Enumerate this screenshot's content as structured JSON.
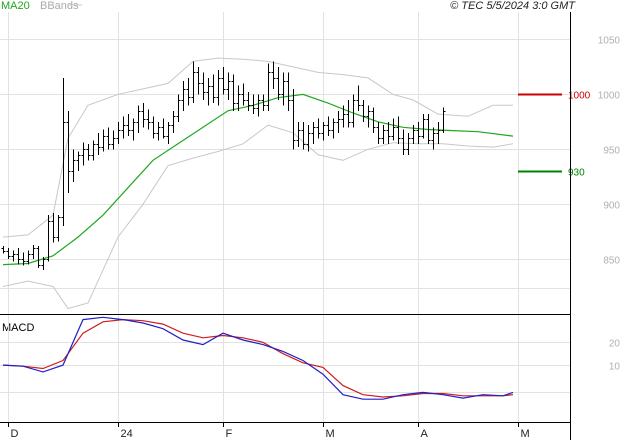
{
  "header": {
    "ma_label": "MA20",
    "bb_label": "BBands",
    "copyright": "© TEC 5/5/2024 3:0 GMT"
  },
  "colors": {
    "candles": "#000000",
    "ma20": "#1fa81f",
    "bbands": "#c8c8c8",
    "resistance": "#cc0000",
    "support": "#008000",
    "macd": "#1f1fcc",
    "signal": "#cc1f1f"
  },
  "chart_data": [
    {
      "type": "line",
      "title": "",
      "x_ticks": [
        {
          "label": "D",
          "index": 1
        },
        {
          "label": "24",
          "index": 23
        },
        {
          "label": "F",
          "index": 44
        },
        {
          "label": "M",
          "index": 64
        },
        {
          "label": "A",
          "index": 83
        },
        {
          "label": "M",
          "index": 103
        }
      ],
      "y_ticks": [
        850,
        900,
        950,
        1000,
        1050
      ],
      "ylim": [
        800,
        1075
      ],
      "grid": true,
      "levels": [
        {
          "name": "resistance",
          "value": 1000,
          "label": "1000"
        },
        {
          "name": "support",
          "value": 930,
          "label": "930"
        }
      ],
      "ohlc": [
        [
          860,
          862,
          855,
          857
        ],
        [
          857,
          860,
          850,
          853
        ],
        [
          853,
          858,
          848,
          855
        ],
        [
          855,
          860,
          845,
          850
        ],
        [
          850,
          856,
          844,
          848
        ],
        [
          848,
          858,
          845,
          855
        ],
        [
          855,
          863,
          850,
          860
        ],
        [
          860,
          862,
          842,
          845
        ],
        [
          845,
          852,
          840,
          850
        ],
        [
          850,
          890,
          848,
          885
        ],
        [
          885,
          892,
          865,
          870
        ],
        [
          870,
          890,
          866,
          888
        ],
        [
          888,
          1015,
          880,
          975
        ],
        [
          975,
          985,
          910,
          930
        ],
        [
          930,
          950,
          920,
          940
        ],
        [
          940,
          948,
          930,
          945
        ],
        [
          945,
          956,
          935,
          950
        ],
        [
          950,
          955,
          940,
          945
        ],
        [
          945,
          958,
          940,
          955
        ],
        [
          955,
          965,
          945,
          952
        ],
        [
          952,
          968,
          948,
          962
        ],
        [
          962,
          970,
          950,
          955
        ],
        [
          955,
          967,
          950,
          960
        ],
        [
          960,
          975,
          955,
          968
        ],
        [
          968,
          980,
          960,
          972
        ],
        [
          972,
          982,
          962,
          968
        ],
        [
          968,
          978,
          958,
          975
        ],
        [
          975,
          990,
          965,
          985
        ],
        [
          985,
          992,
          970,
          978
        ],
        [
          978,
          986,
          968,
          975
        ],
        [
          975,
          980,
          960,
          965
        ],
        [
          965,
          975,
          958,
          970
        ],
        [
          970,
          978,
          960,
          962
        ],
        [
          962,
          975,
          955,
          972
        ],
        [
          972,
          985,
          965,
          980
        ],
        [
          980,
          1000,
          975,
          995
        ],
        [
          995,
          1012,
          985,
          1005
        ],
        [
          1005,
          1015,
          990,
          998
        ],
        [
          998,
          1030,
          992,
          1020
        ],
        [
          1020,
          1025,
          1000,
          1010
        ],
        [
          1010,
          1020,
          995,
          1002
        ],
        [
          1002,
          1015,
          990,
          1008
        ],
        [
          1008,
          1018,
          992,
          998
        ],
        [
          998,
          1022,
          990,
          1015
        ],
        [
          1015,
          1025,
          1000,
          1005
        ],
        [
          1005,
          1020,
          995,
          1012
        ],
        [
          1012,
          1018,
          985,
          992
        ],
        [
          992,
          1008,
          985,
          1000
        ],
        [
          1000,
          1010,
          990,
          995
        ],
        [
          995,
          1002,
          985,
          990
        ],
        [
          990,
          1000,
          982,
          988
        ],
        [
          988,
          1000,
          980,
          995
        ],
        [
          995,
          1000,
          985,
          990
        ],
        [
          990,
          1028,
          985,
          1020
        ],
        [
          1020,
          1030,
          1005,
          1015
        ],
        [
          1015,
          1025,
          995,
          1000
        ],
        [
          1000,
          1020,
          990,
          1012
        ],
        [
          1012,
          1020,
          985,
          995
        ],
        [
          995,
          1005,
          950,
          958
        ],
        [
          958,
          975,
          952,
          968
        ],
        [
          968,
          975,
          950,
          955
        ],
        [
          955,
          972,
          948,
          965
        ],
        [
          965,
          975,
          955,
          970
        ],
        [
          970,
          978,
          960,
          965
        ],
        [
          965,
          975,
          958,
          972
        ],
        [
          972,
          980,
          962,
          968
        ],
        [
          968,
          978,
          960,
          975
        ],
        [
          975,
          985,
          965,
          978
        ],
        [
          978,
          990,
          970,
          982
        ],
        [
          982,
          995,
          970,
          975
        ],
        [
          975,
          1000,
          970,
          995
        ],
        [
          995,
          1008,
          985,
          990
        ],
        [
          990,
          995,
          975,
          980
        ],
        [
          980,
          990,
          970,
          985
        ],
        [
          985,
          988,
          965,
          970
        ],
        [
          970,
          975,
          955,
          960
        ],
        [
          960,
          972,
          955,
          968
        ],
        [
          968,
          975,
          955,
          962
        ],
        [
          962,
          978,
          958,
          970
        ],
        [
          970,
          980,
          955,
          960
        ],
        [
          960,
          968,
          945,
          950
        ],
        [
          950,
          965,
          945,
          960
        ],
        [
          960,
          972,
          955,
          968
        ],
        [
          968,
          975,
          955,
          962
        ],
        [
          962,
          982,
          960,
          978
        ],
        [
          978,
          982,
          955,
          958
        ],
        [
          958,
          970,
          950,
          965
        ],
        [
          965,
          975,
          955,
          968
        ],
        [
          968,
          988,
          965,
          985
        ]
      ],
      "ma20": [
        [
          0,
          845
        ],
        [
          5,
          846
        ],
        [
          10,
          853
        ],
        [
          15,
          870
        ],
        [
          20,
          890
        ],
        [
          25,
          915
        ],
        [
          30,
          940
        ],
        [
          35,
          955
        ],
        [
          40,
          970
        ],
        [
          45,
          985
        ],
        [
          50,
          990
        ],
        [
          55,
          997
        ],
        [
          60,
          1000
        ],
        [
          65,
          992
        ],
        [
          70,
          983
        ],
        [
          75,
          975
        ],
        [
          80,
          970
        ],
        [
          85,
          968
        ],
        [
          90,
          967
        ],
        [
          95,
          966
        ],
        [
          102,
          962
        ]
      ],
      "bb_upper": [
        [
          0,
          870
        ],
        [
          5,
          872
        ],
        [
          10,
          890
        ],
        [
          13,
          960
        ],
        [
          17,
          990
        ],
        [
          23,
          1000
        ],
        [
          28,
          1005
        ],
        [
          33,
          1010
        ],
        [
          38,
          1030
        ],
        [
          43,
          1033
        ],
        [
          48,
          1032
        ],
        [
          53,
          1030
        ],
        [
          58,
          1025
        ],
        [
          63,
          1020
        ],
        [
          68,
          1018
        ],
        [
          73,
          1015
        ],
        [
          78,
          1000
        ],
        [
          82,
          995
        ],
        [
          87,
          982
        ],
        [
          93,
          980
        ],
        [
          98,
          990
        ],
        [
          102,
          990
        ]
      ],
      "bb_lower": [
        [
          0,
          825
        ],
        [
          5,
          830
        ],
        [
          10,
          825
        ],
        [
          13,
          805
        ],
        [
          17,
          810
        ],
        [
          20,
          840
        ],
        [
          23,
          870
        ],
        [
          28,
          900
        ],
        [
          33,
          935
        ],
        [
          38,
          942
        ],
        [
          43,
          948
        ],
        [
          48,
          955
        ],
        [
          53,
          972
        ],
        [
          58,
          965
        ],
        [
          63,
          945
        ],
        [
          68,
          940
        ],
        [
          73,
          950
        ],
        [
          78,
          956
        ],
        [
          83,
          955
        ],
        [
          88,
          955
        ],
        [
          93,
          953
        ],
        [
          98,
          952
        ],
        [
          102,
          955
        ]
      ]
    },
    {
      "type": "line",
      "title": "MACD",
      "y_ticks": [
        {
          "value": 20,
          "label": "20"
        },
        {
          "value": 10,
          "label": "10"
        }
      ],
      "ylim": [
        -15,
        32
      ],
      "grid": true,
      "series": [
        {
          "key": "macd",
          "values": [
            [
              0,
              10
            ],
            [
              4,
              9.5
            ],
            [
              8,
              7
            ],
            [
              12,
              10
            ],
            [
              16,
              30
            ],
            [
              20,
              31
            ],
            [
              24,
              30
            ],
            [
              28,
              28.5
            ],
            [
              32,
              26
            ],
            [
              36,
              21
            ],
            [
              40,
              19
            ],
            [
              44,
              24
            ],
            [
              48,
              21
            ],
            [
              52,
              19
            ],
            [
              56,
              16
            ],
            [
              60,
              12
            ],
            [
              64,
              6
            ],
            [
              68,
              -3
            ],
            [
              72,
              -5
            ],
            [
              76,
              -5
            ],
            [
              80,
              -3
            ],
            [
              84,
              -2
            ],
            [
              88,
              -3
            ],
            [
              92,
              -4.5
            ],
            [
              96,
              -3
            ],
            [
              100,
              -3.5
            ],
            [
              102,
              -2
            ]
          ]
        },
        {
          "key": "signal",
          "values": [
            [
              0,
              10
            ],
            [
              4,
              9.5
            ],
            [
              8,
              8.5
            ],
            [
              12,
              12
            ],
            [
              16,
              24
            ],
            [
              20,
              29
            ],
            [
              24,
              30
            ],
            [
              28,
              29.5
            ],
            [
              32,
              28
            ],
            [
              36,
              24
            ],
            [
              40,
              22
            ],
            [
              44,
              23
            ],
            [
              48,
              22
            ],
            [
              52,
              20
            ],
            [
              56,
              15
            ],
            [
              60,
              11
            ],
            [
              64,
              9
            ],
            [
              68,
              1
            ],
            [
              72,
              -3
            ],
            [
              76,
              -4
            ],
            [
              80,
              -3.5
            ],
            [
              84,
              -2.5
            ],
            [
              88,
              -2.5
            ],
            [
              92,
              -3.5
            ],
            [
              96,
              -3.5
            ],
            [
              100,
              -3.5
            ],
            [
              102,
              -3
            ]
          ]
        }
      ]
    }
  ]
}
